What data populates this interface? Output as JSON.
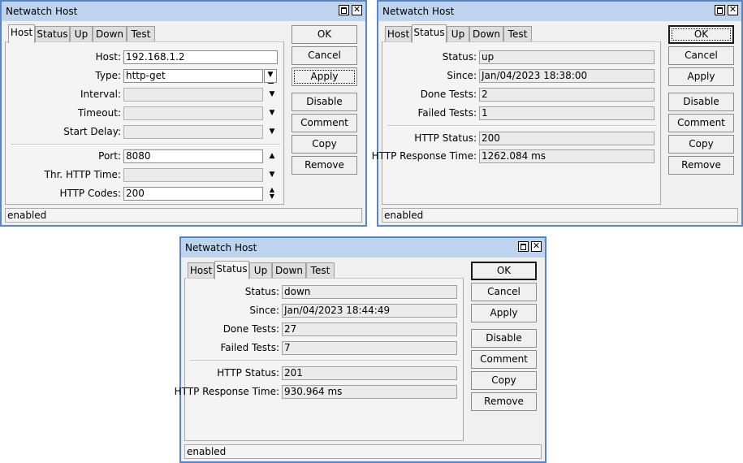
{
  "windows": [
    {
      "title": "Netwatch Host",
      "tabs": [
        "Host",
        "Status",
        "Up",
        "Down",
        "Test"
      ],
      "active_tab": "Host",
      "fields": {
        "host": {
          "label": "Host:",
          "value": "192.168.1.2"
        },
        "type": {
          "label": "Type:",
          "value": "http-get"
        },
        "interval": {
          "label": "Interval:",
          "value": ""
        },
        "timeout": {
          "label": "Timeout:",
          "value": ""
        },
        "start_delay": {
          "label": "Start Delay:",
          "value": ""
        },
        "port": {
          "label": "Port:",
          "value": "8080"
        },
        "thr_http_time": {
          "label": "Thr. HTTP Time:",
          "value": ""
        },
        "http_codes": {
          "label": "HTTP Codes:",
          "value": "200"
        }
      },
      "buttons": [
        "OK",
        "Cancel",
        "Apply",
        "Disable",
        "Comment",
        "Copy",
        "Remove"
      ],
      "status": "enabled"
    },
    {
      "title": "Netwatch Host",
      "tabs": [
        "Host",
        "Status",
        "Up",
        "Down",
        "Test"
      ],
      "active_tab": "Status",
      "fields": {
        "status": {
          "label": "Status:",
          "value": "up"
        },
        "since": {
          "label": "Since:",
          "value": "Jan/04/2023 18:38:00"
        },
        "done_tests": {
          "label": "Done Tests:",
          "value": "2"
        },
        "failed_tests": {
          "label": "Failed Tests:",
          "value": "1"
        },
        "http_status": {
          "label": "HTTP Status:",
          "value": "200"
        },
        "http_response_time": {
          "label": "HTTP Response Time:",
          "value": "1262.084 ms"
        }
      },
      "buttons": [
        "OK",
        "Cancel",
        "Apply",
        "Disable",
        "Comment",
        "Copy",
        "Remove"
      ],
      "status": "enabled"
    },
    {
      "title": "Netwatch Host",
      "tabs": [
        "Host",
        "Status",
        "Up",
        "Down",
        "Test"
      ],
      "active_tab": "Status",
      "fields": {
        "status": {
          "label": "Status:",
          "value": "down"
        },
        "since": {
          "label": "Since:",
          "value": "Jan/04/2023 18:44:49"
        },
        "done_tests": {
          "label": "Done Tests:",
          "value": "27"
        },
        "failed_tests": {
          "label": "Failed Tests:",
          "value": "7"
        },
        "http_status": {
          "label": "HTTP Status:",
          "value": "201"
        },
        "http_response_time": {
          "label": "HTTP Response Time:",
          "value": "930.964 ms"
        }
      },
      "buttons": [
        "OK",
        "Cancel",
        "Apply",
        "Disable",
        "Comment",
        "Copy",
        "Remove"
      ],
      "status": "enabled"
    }
  ],
  "window_controls": {
    "maximize": "maximize-icon",
    "close": "close-icon"
  },
  "icons": {
    "dropdown": "dropdown-arrow-icon",
    "combo": "combo-dropdown-icon",
    "spin_up": "spin-up-icon",
    "spinner": "spinner-icon"
  },
  "colors": {
    "titlebar": "#bdd3ee",
    "window_border": "#5a84c8",
    "background": "#f0f0f0"
  }
}
